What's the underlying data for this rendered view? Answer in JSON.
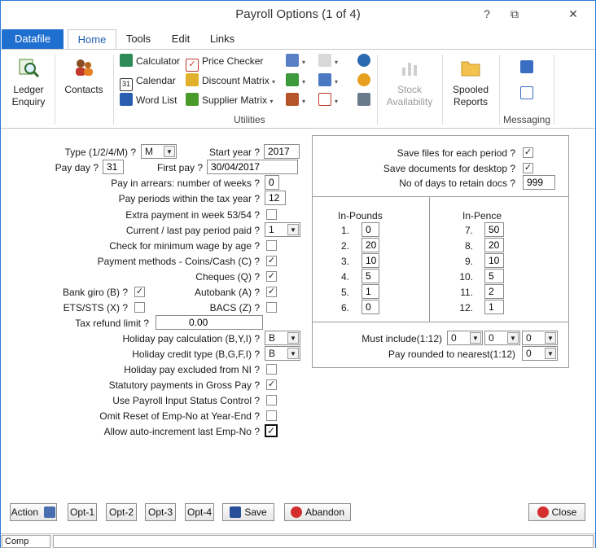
{
  "window": {
    "title": "Payroll Options (1 of 4)",
    "help": "?",
    "restore": "⧉",
    "close": "✕"
  },
  "tabs": [
    "Datafile",
    "Home",
    "Tools",
    "Edit",
    "Links"
  ],
  "ribbon": {
    "ledger_enquiry": "Ledger Enquiry",
    "contacts": "Contacts",
    "calculator": "Calculator",
    "calendar": "Calendar",
    "word_list": "Word List",
    "price_checker": "Price Checker",
    "discount_matrix": "Discount Matrix",
    "supplier_matrix": "Supplier Matrix",
    "utilities_label": "Utilities",
    "stock_availability": "Stock Availability",
    "spooled_reports": "Spooled Reports",
    "messaging_label": "Messaging",
    "dropdown_glyph": "▾"
  },
  "form": {
    "type_label": "Type (1/2/4/M) ?",
    "type_value": "M",
    "start_year_label": "Start year ?",
    "start_year_value": "2017",
    "pay_day_label": "Pay day ?",
    "pay_day_value": "31",
    "first_pay_label": "First pay ?",
    "first_pay_value": "30/04/2017",
    "arrears_label": "Pay in arrears: number of weeks ?",
    "arrears_value": "0",
    "periods_label": "Pay periods within the tax year ?",
    "periods_value": "12",
    "extra_payment_label": "Extra payment in week 53/54 ?",
    "current_period_label": "Current / last pay period paid ?",
    "current_period_value": "1",
    "min_wage_label": "Check for minimum wage by age ?",
    "coins_cash_label": "Payment methods - Coins/Cash (C) ?",
    "cheques_label": "Cheques (Q) ?",
    "bank_giro_label": "Bank giro (B) ?",
    "autobank_label": "Autobank (A) ?",
    "ets_sts_label": "ETS/STS (X) ?",
    "bacs_label": "BACS (Z) ?",
    "tax_refund_label": "Tax refund limit ?",
    "tax_refund_value": "0.00",
    "holiday_calc_label": "Holiday pay calculation (B,Y,I) ?",
    "holiday_calc_value": "B",
    "holiday_credit_label": "Holiday credit type (B,G,F,I) ?",
    "holiday_credit_value": "B",
    "holiday_excluded_label": "Holiday pay excluded from NI ?",
    "statutory_label": "Statutory payments in Gross Pay ?",
    "input_status_label": "Use Payroll Input Status Control ?",
    "omit_reset_label": "Omit Reset of Emp-No at Year-End ?",
    "auto_increment_label": "Allow auto-increment last Emp-No ?",
    "check_glyph": "✓"
  },
  "docs": {
    "save_files_label": "Save files for each period ?",
    "save_desktop_label": "Save documents for desktop ?",
    "retain_label": "No of days to retain docs ?",
    "retain_value": "999"
  },
  "coins": {
    "pounds_header": "In-Pounds",
    "pence_header": "In-Pence",
    "pounds": [
      {
        "n": "1.",
        "v": "0"
      },
      {
        "n": "2.",
        "v": "20"
      },
      {
        "n": "3.",
        "v": "10"
      },
      {
        "n": "4.",
        "v": "5"
      },
      {
        "n": "5.",
        "v": "1"
      },
      {
        "n": "6.",
        "v": "0"
      }
    ],
    "pence": [
      {
        "n": "7.",
        "v": "50"
      },
      {
        "n": "8.",
        "v": "20"
      },
      {
        "n": "9.",
        "v": "10"
      },
      {
        "n": "10.",
        "v": "5"
      },
      {
        "n": "11.",
        "v": "2"
      },
      {
        "n": "12.",
        "v": "1"
      }
    ],
    "must_include_label": "Must include(1:12)",
    "must_include_values": [
      "0",
      "0",
      "0"
    ],
    "rounded_label": "Pay rounded to nearest(1:12)",
    "rounded_value": "0"
  },
  "buttons": {
    "action": "Action",
    "opt1": "Opt-1",
    "opt2": "Opt-2",
    "opt3": "Opt-3",
    "opt4": "Opt-4",
    "save": "Save",
    "abandon": "Abandon",
    "close": "Close"
  },
  "status": {
    "company": "Comp DEM"
  },
  "colors": {
    "accent": "#1f6fd0",
    "ribbon_active": "#1f5fb0"
  }
}
